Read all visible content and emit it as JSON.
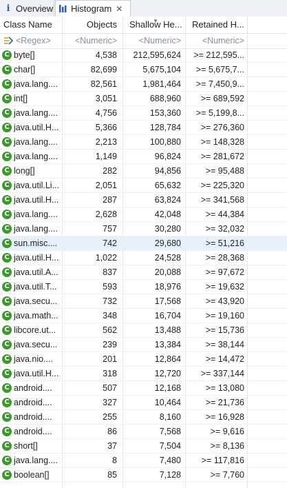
{
  "tabs": {
    "overview": "Overview",
    "histogram": "Histogram",
    "close": "✕"
  },
  "columns": {
    "class_name": "Class Name",
    "objects": "Objects",
    "shallow": "Shallow He...",
    "retained": "Retained H..."
  },
  "filters": {
    "class_name": "<Regex>",
    "objects": "<Numeric>",
    "shallow": "<Numeric>",
    "retained": "<Numeric>"
  },
  "class_icon_glyph": "C",
  "rows": [
    {
      "name": "byte[]",
      "objects": "4,538",
      "shallow": "212,595,624",
      "retained": ">= 212,595..."
    },
    {
      "name": "char[]",
      "objects": "82,699",
      "shallow": "5,675,104",
      "retained": ">= 5,675,7..."
    },
    {
      "name": "java.lang....",
      "objects": "82,561",
      "shallow": "1,981,464",
      "retained": ">= 7,450,9..."
    },
    {
      "name": "int[]",
      "objects": "3,051",
      "shallow": "688,960",
      "retained": ">= 689,592"
    },
    {
      "name": "java.lang....",
      "objects": "4,756",
      "shallow": "153,360",
      "retained": ">= 5,199,8..."
    },
    {
      "name": "java.util.H...",
      "objects": "5,366",
      "shallow": "128,784",
      "retained": ">= 276,360"
    },
    {
      "name": "java.lang....",
      "objects": "2,213",
      "shallow": "100,880",
      "retained": ">= 148,328"
    },
    {
      "name": "java.lang....",
      "objects": "1,149",
      "shallow": "96,824",
      "retained": ">= 281,672"
    },
    {
      "name": "long[]",
      "objects": "282",
      "shallow": "94,856",
      "retained": ">= 95,488"
    },
    {
      "name": "java.util.Li...",
      "objects": "2,051",
      "shallow": "65,632",
      "retained": ">= 225,320"
    },
    {
      "name": "java.util.H...",
      "objects": "287",
      "shallow": "63,824",
      "retained": ">= 341,568"
    },
    {
      "name": "java.lang....",
      "objects": "2,628",
      "shallow": "42,048",
      "retained": ">= 44,384"
    },
    {
      "name": "java.lang....",
      "objects": "757",
      "shallow": "30,280",
      "retained": ">= 32,032"
    },
    {
      "name": "sun.misc....",
      "objects": "742",
      "shallow": "29,680",
      "retained": ">= 51,216",
      "selected": true
    },
    {
      "name": "java.util.H...",
      "objects": "1,022",
      "shallow": "24,528",
      "retained": ">= 28,368"
    },
    {
      "name": "java.util.A...",
      "objects": "837",
      "shallow": "20,088",
      "retained": ">= 97,672"
    },
    {
      "name": "java.util.T...",
      "objects": "593",
      "shallow": "18,976",
      "retained": ">= 19,632"
    },
    {
      "name": "java.secu...",
      "objects": "732",
      "shallow": "17,568",
      "retained": ">= 43,920"
    },
    {
      "name": "java.math...",
      "objects": "348",
      "shallow": "16,704",
      "retained": ">= 19,160"
    },
    {
      "name": "libcore.ut...",
      "objects": "562",
      "shallow": "13,488",
      "retained": ">= 15,736"
    },
    {
      "name": "java.secu...",
      "objects": "239",
      "shallow": "13,384",
      "retained": ">= 38,144"
    },
    {
      "name": "java.nio....",
      "objects": "201",
      "shallow": "12,864",
      "retained": ">= 14,472"
    },
    {
      "name": "java.util.H...",
      "objects": "318",
      "shallow": "12,720",
      "retained": ">= 337,144"
    },
    {
      "name": "android....",
      "objects": "507",
      "shallow": "12,168",
      "retained": ">= 13,080"
    },
    {
      "name": "android....",
      "objects": "327",
      "shallow": "10,464",
      "retained": ">= 21,736"
    },
    {
      "name": "android....",
      "objects": "255",
      "shallow": "8,160",
      "retained": ">= 16,928"
    },
    {
      "name": "android....",
      "objects": "86",
      "shallow": "7,568",
      "retained": ">= 9,616"
    },
    {
      "name": "short[]",
      "objects": "37",
      "shallow": "7,504",
      "retained": ">= 8,136"
    },
    {
      "name": "java.lang....",
      "objects": "8",
      "shallow": "7,480",
      "retained": ">= 117,816"
    },
    {
      "name": "boolean[]",
      "objects": "85",
      "shallow": "7,128",
      "retained": ">= 7,760"
    }
  ]
}
